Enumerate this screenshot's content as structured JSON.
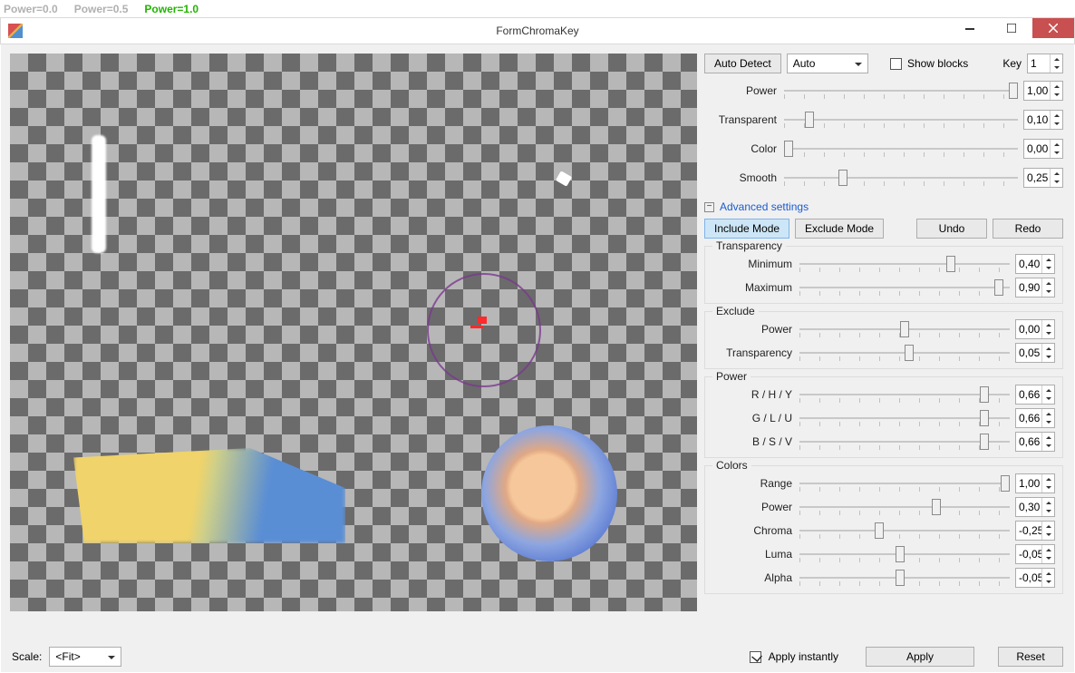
{
  "top_strip": {
    "p0": "Power=0.0",
    "p05": "Power=0.5",
    "p1": "Power=1.0"
  },
  "window": {
    "title": "FormChromaKey"
  },
  "toolbar": {
    "auto_detect": "Auto Detect",
    "auto_combo": "Auto",
    "show_blocks_label": "Show blocks",
    "show_blocks_checked": false,
    "key_label": "Key",
    "key_value": "1"
  },
  "main_sliders": {
    "power": {
      "label": "Power",
      "value": "1,00",
      "pos": 0.98
    },
    "transparent": {
      "label": "Transparent",
      "value": "0,10",
      "pos": 0.11
    },
    "color": {
      "label": "Color",
      "value": "0,00",
      "pos": 0.02
    },
    "smooth": {
      "label": "Smooth",
      "value": "0,25",
      "pos": 0.25
    }
  },
  "advanced": {
    "header": "Advanced settings",
    "include_mode": "Include Mode",
    "exclude_mode": "Exclude Mode",
    "undo": "Undo",
    "redo": "Redo",
    "transparency": {
      "title": "Transparency",
      "min": {
        "label": "Minimum",
        "value": "0,40",
        "pos": 0.72
      },
      "max": {
        "label": "Maximum",
        "value": "0,90",
        "pos": 0.95
      }
    },
    "exclude": {
      "title": "Exclude",
      "power": {
        "label": "Power",
        "value": "0,00",
        "pos": 0.5
      },
      "transparency": {
        "label": "Transparency",
        "value": "0,05",
        "pos": 0.52
      }
    },
    "power_group": {
      "title": "Power",
      "rhy": {
        "label": "R / H / Y",
        "value": "0,66",
        "pos": 0.88
      },
      "glu": {
        "label": "G / L / U",
        "value": "0,66",
        "pos": 0.88
      },
      "bsv": {
        "label": "B / S / V",
        "value": "0,66",
        "pos": 0.88
      }
    },
    "colors": {
      "title": "Colors",
      "range": {
        "label": "Range",
        "value": "1,00",
        "pos": 0.98
      },
      "power": {
        "label": "Power",
        "value": "0,30",
        "pos": 0.65
      },
      "chroma": {
        "label": "Chroma",
        "value": "-0,25",
        "pos": 0.38
      },
      "luma": {
        "label": "Luma",
        "value": "-0,05",
        "pos": 0.48
      },
      "alpha": {
        "label": "Alpha",
        "value": "-0,05",
        "pos": 0.48
      }
    }
  },
  "bottom": {
    "scale_label": "Scale:",
    "scale_value": "<Fit>",
    "apply_instantly_label": "Apply instantly",
    "apply_instantly_checked": true,
    "apply": "Apply",
    "reset": "Reset"
  }
}
